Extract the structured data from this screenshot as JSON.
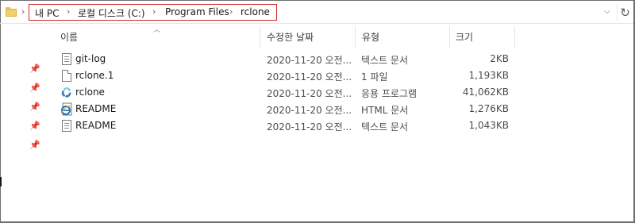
{
  "address": {
    "crumbs": [
      "내 PC",
      "로컬 디스크 (C:)",
      "Program Files",
      "rclone"
    ],
    "separator": "›"
  },
  "columns": {
    "name": "이름",
    "date": "수정한 날짜",
    "type": "유형",
    "size": "크기"
  },
  "files": [
    {
      "name": "git-log",
      "date": "2020-11-20 오전...",
      "type": "텍스트 문서",
      "size": "2KB",
      "icon": "text-document-icon"
    },
    {
      "name": "rclone.1",
      "date": "2020-11-20 오전...",
      "type": "1 파일",
      "size": "1,193KB",
      "icon": "blank-file-icon"
    },
    {
      "name": "rclone",
      "date": "2020-11-20 오전...",
      "type": "응용 프로그램",
      "size": "41,062KB",
      "icon": "rclone-app-icon"
    },
    {
      "name": "README",
      "date": "2020-11-20 오전...",
      "type": "HTML 문서",
      "size": "1,276KB",
      "icon": "html-document-icon"
    },
    {
      "name": "README",
      "date": "2020-11-20 오전...",
      "type": "텍스트 문서",
      "size": "1,043KB",
      "icon": "text-document-icon"
    }
  ],
  "colors": {
    "address_highlight": "#d0282e",
    "folder": "#f3d06c",
    "rclone_blue": "#3f79ad",
    "rclone_green": "#70caf2",
    "ie_blue": "#1e73be"
  }
}
